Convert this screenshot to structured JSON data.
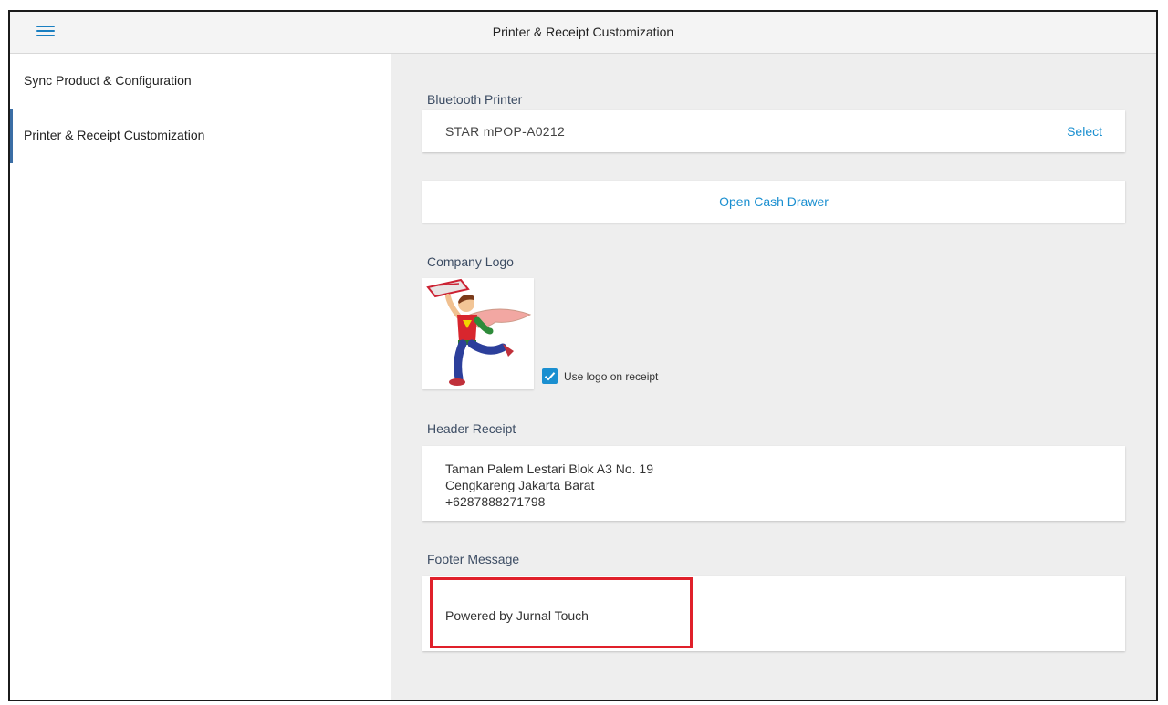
{
  "topbar": {
    "title": "Printer & Receipt Customization",
    "menu_icon": "hamburger-menu-icon"
  },
  "sidebar": {
    "items": [
      {
        "label": "Sync Product & Configuration",
        "active": false
      },
      {
        "label": "Printer & Receipt Customization",
        "active": true
      }
    ]
  },
  "bluetooth": {
    "label": "Bluetooth Printer",
    "printer_name": "STAR mPOP-A0212",
    "select_label": "Select"
  },
  "cash_drawer": {
    "label": "Open Cash Drawer"
  },
  "logo": {
    "label": "Company Logo",
    "checkbox_label": "Use logo on receipt",
    "checked": true
  },
  "header_receipt": {
    "label": "Header Receipt",
    "value": "Taman Palem Lestari Blok A3 No. 19\nCengkareng Jakarta Barat\n+6287888271798"
  },
  "footer_message": {
    "label": "Footer Message",
    "value": "Powered by Jurnal Touch"
  },
  "colors": {
    "accent": "#1a8fd0",
    "highlight": "#e0202a",
    "background": "#eeeeee"
  }
}
